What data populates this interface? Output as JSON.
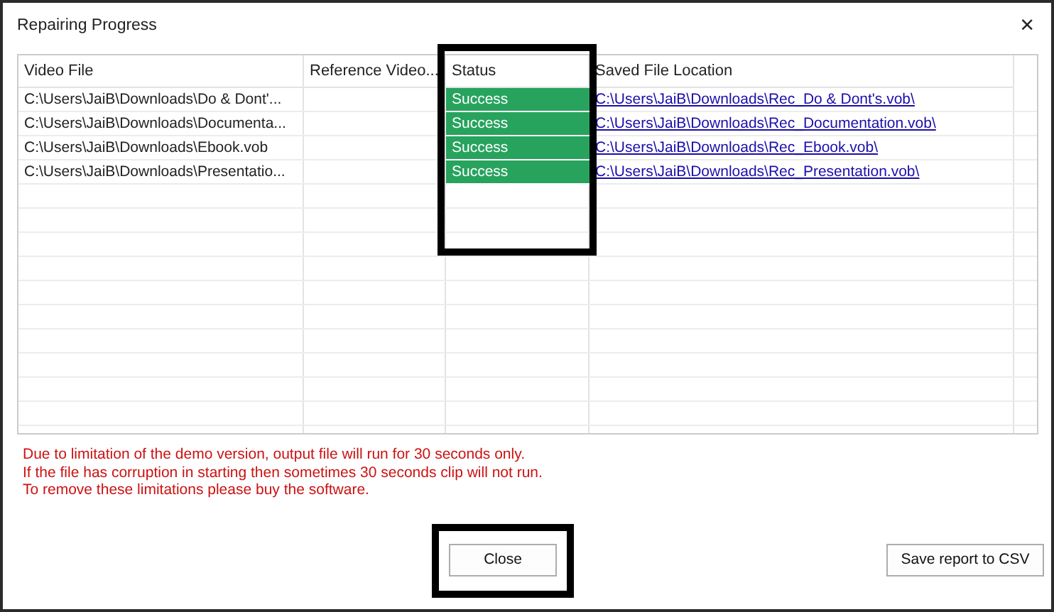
{
  "window": {
    "title": "Repairing Progress",
    "close": "×"
  },
  "table": {
    "columns": [
      {
        "label": "Video File",
        "highlighted": false
      },
      {
        "label": "Reference Video...",
        "highlighted": false
      },
      {
        "label": "Status",
        "highlighted": true
      },
      {
        "label": "Saved File Location",
        "highlighted": false
      }
    ],
    "rows": [
      {
        "video_file": "C:\\Users\\JaiB\\Downloads\\Do & Dont'...",
        "reference_video": "",
        "status": "Success",
        "saved_location": "C:\\Users\\JaiB\\Downloads\\Rec_Do & Dont's.vob\\"
      },
      {
        "video_file": "C:\\Users\\JaiB\\Downloads\\Documenta...",
        "reference_video": "",
        "status": "Success",
        "saved_location": "C:\\Users\\JaiB\\Downloads\\Rec_Documentation.vob\\"
      },
      {
        "video_file": "C:\\Users\\JaiB\\Downloads\\Ebook.vob",
        "reference_video": "",
        "status": "Success",
        "saved_location": "C:\\Users\\JaiB\\Downloads\\Rec_Ebook.vob\\"
      },
      {
        "video_file": "C:\\Users\\JaiB\\Downloads\\Presentatio...",
        "reference_video": "",
        "status": "Success",
        "saved_location": "C:\\Users\\JaiB\\Downloads\\Rec_Presentation.vob\\"
      }
    ]
  },
  "notice": [
    "Due to limitation of the demo version, output file will run for 30 seconds only.",
    "If the file has corruption in starting then sometimes 30 seconds clip will not run.",
    "To remove these limitations please buy the software."
  ],
  "buttons": [
    {
      "label": "Close",
      "kind": "close",
      "highlighted": true
    },
    {
      "label": "Save report to CSV",
      "kind": "export",
      "highlighted": false
    }
  ]
}
